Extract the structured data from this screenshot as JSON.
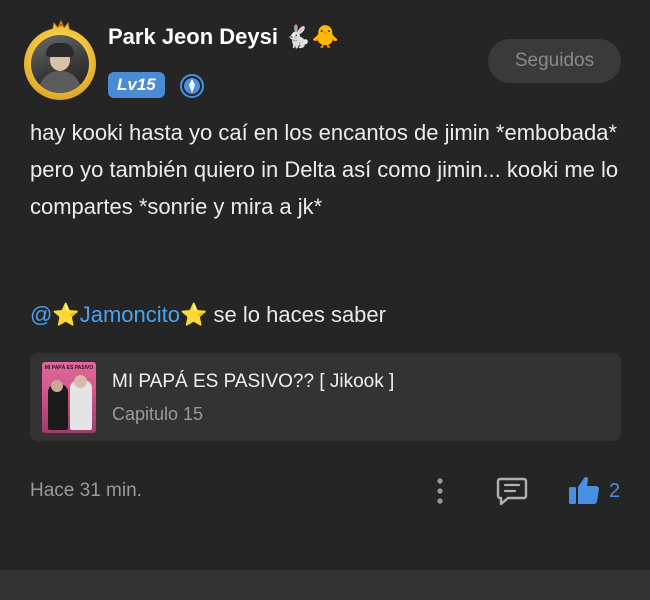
{
  "header": {
    "username": "Park Jeon Deysi",
    "username_emoji": "🐇🐥",
    "level": "Lv15",
    "follow_label": "Seguidos"
  },
  "post": {
    "text": "hay kooki hasta yo caí en los encantos de jimin *embobada*  pero yo también quiero in Delta así como jimin... kooki me lo compartes *sonrie y mira a jk*",
    "mention_at": "@",
    "mention_star": "⭐",
    "mention_name": "Jamoncito",
    "mention_tail": " se lo haces saber"
  },
  "linked_card": {
    "cover_title": "MI PAPÁ ES PASIVO",
    "title": "MI PAPÁ ES PASIVO?? [ Jikook ]",
    "subtitle": "Capitulo 15"
  },
  "footer": {
    "timestamp": "Hace 31 min.",
    "like_count": "2"
  },
  "icons": {
    "verified": "verified-badge-icon",
    "more": "more-vertical-icon",
    "comment": "comment-icon",
    "like": "thumbs-up-icon"
  },
  "colors": {
    "background": "#252525",
    "accent_blue": "#4a90e2",
    "mention_blue": "#4aa3f0",
    "level_badge": "#4a8bd6",
    "follow_button": "#3a3a3a",
    "card_bg": "#333333"
  }
}
